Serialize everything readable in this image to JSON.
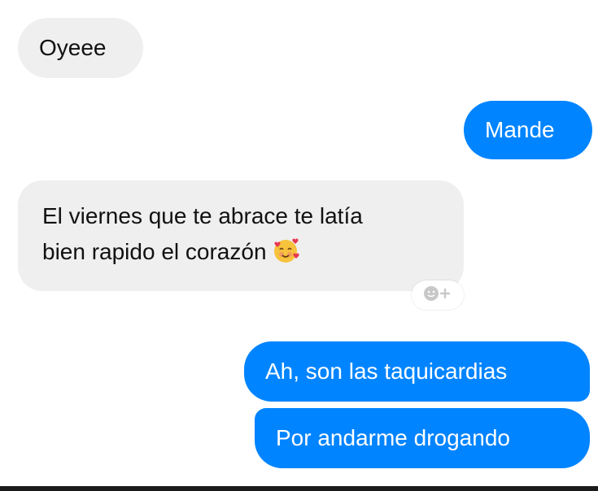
{
  "messages": [
    {
      "direction": "incoming",
      "text": "Oyeee"
    },
    {
      "direction": "outgoing",
      "text": "Mande"
    },
    {
      "direction": "incoming",
      "lines": [
        "El viernes que te abrace te latía",
        "bien rapido el corazón"
      ],
      "emoji": "smiling-face-with-hearts-icon"
    },
    {
      "direction": "outgoing",
      "text": "Ah, son las taquicardias"
    },
    {
      "direction": "outgoing",
      "text": "Por andarme drogando"
    }
  ],
  "reaction_button": {
    "icon": "add-reaction-icon"
  },
  "colors": {
    "incoming_bg": "#efefef",
    "outgoing_bg": "#0084ff",
    "incoming_text": "#111111",
    "outgoing_text": "#ffffff"
  }
}
